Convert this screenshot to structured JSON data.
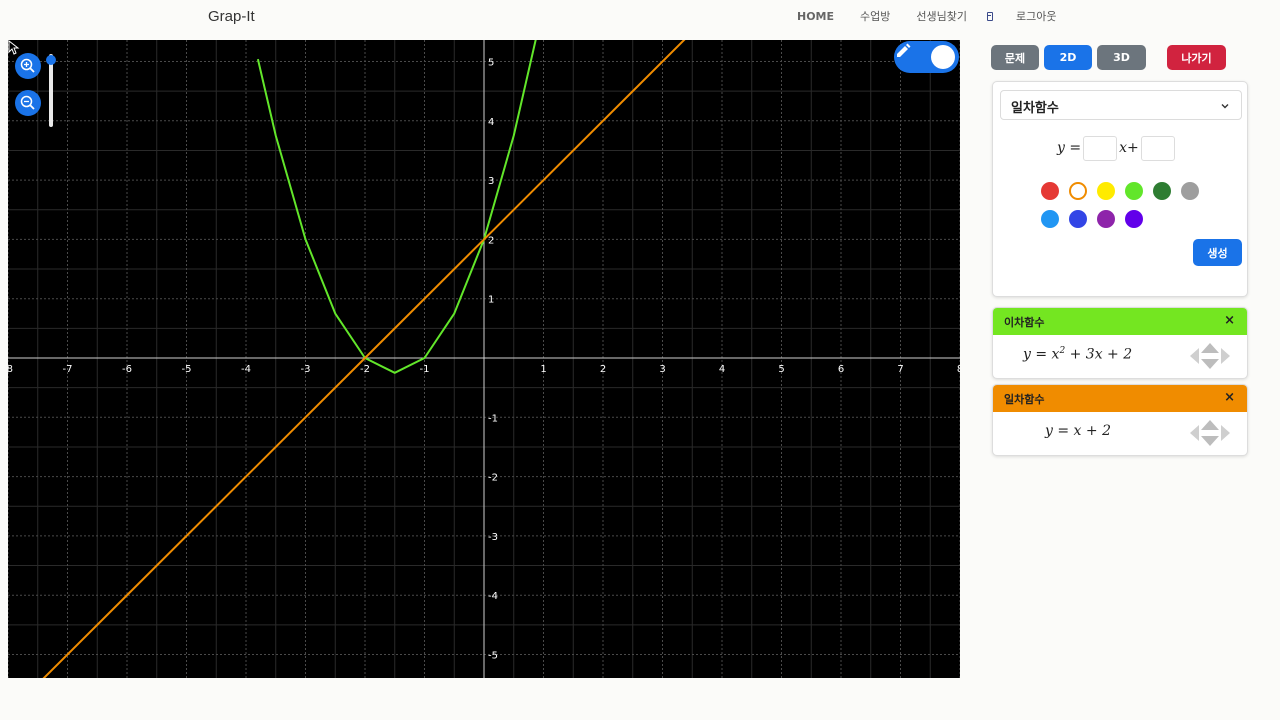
{
  "app": {
    "title": "Grap-It"
  },
  "nav": {
    "home": "HOME",
    "classroom": "수업방",
    "find_teacher": "선생님찾기",
    "logout": "로그아웃"
  },
  "modes": {
    "problem": "문제",
    "two_d": "2D",
    "three_d": "3D",
    "exit": "나가기"
  },
  "creator": {
    "function_type": "일차함수",
    "equation_prefix": "y =",
    "equation_middle": "x+",
    "slope_value": "",
    "intercept_value": "",
    "colors": [
      "#e53935",
      "#ffffff",
      "#ffeb00",
      "#62e62a",
      "#2e7d32",
      "#9e9e9e",
      "#2196f3",
      "#3245e6",
      "#8e24aa",
      "#6200ea"
    ],
    "selected_color": "#f08c00",
    "create_label": "생성"
  },
  "functions": [
    {
      "title": "이차함수",
      "formula_html": "y = x<sup>2</sup> + 3x + 2",
      "color": "#74e621",
      "close": "×"
    },
    {
      "title": "일차함수",
      "formula_html": "y = x + 2",
      "color": "#f08c00",
      "close": "×"
    }
  ],
  "chart_data": {
    "type": "line",
    "xlim": [
      -8,
      8
    ],
    "ylim": [
      -5.4,
      5.4
    ],
    "x_ticks": [
      -8,
      -7,
      -6,
      -5,
      -4,
      -3,
      -2,
      -1,
      1,
      2,
      3,
      4,
      5,
      6,
      7,
      8
    ],
    "y_ticks": [
      -5,
      -4,
      -3,
      -2,
      -1,
      1,
      2,
      3,
      4,
      5
    ],
    "grid": true,
    "background": "#000000",
    "series": [
      {
        "name": "y = x^2 + 3x + 2",
        "expression": "x^2 + 3x + 2",
        "color": "#62e62a",
        "points": [
          [
            -3.8,
            5.04
          ],
          [
            -3.5,
            3.75
          ],
          [
            -3,
            2
          ],
          [
            -2.5,
            0.75
          ],
          [
            -2,
            0
          ],
          [
            -1.5,
            -0.25
          ],
          [
            -1,
            0
          ],
          [
            -0.5,
            0.75
          ],
          [
            0,
            2
          ],
          [
            0.5,
            3.75
          ],
          [
            0.87,
            5.37
          ]
        ]
      },
      {
        "name": "y = x + 2",
        "expression": "x + 2",
        "color": "#f08c00",
        "points": [
          [
            -8,
            -6
          ],
          [
            -4,
            -2
          ],
          [
            -2,
            0
          ],
          [
            0,
            2
          ],
          [
            3.4,
            5.4
          ]
        ]
      }
    ]
  }
}
